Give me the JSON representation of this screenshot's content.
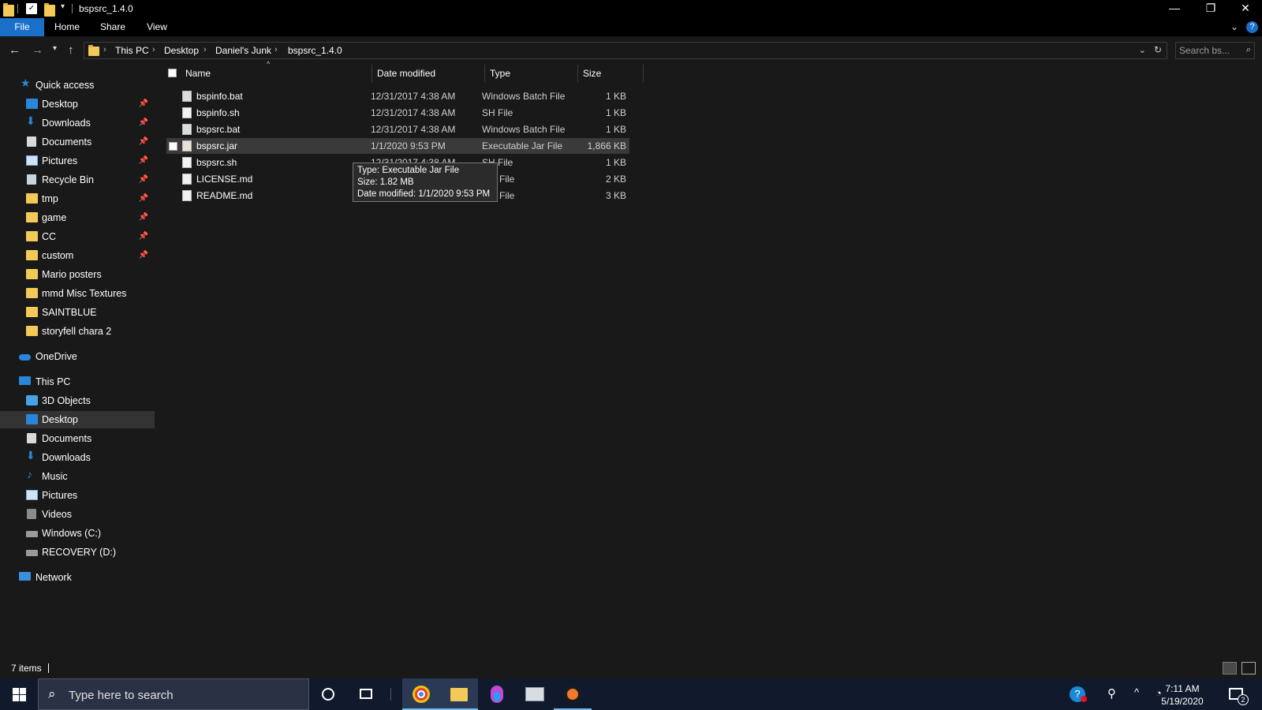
{
  "window": {
    "title": "bspsrc_1.4.0",
    "controls": {
      "minimize": "—",
      "restore": "❐",
      "close": "✕"
    }
  },
  "ribbon": {
    "tabs": [
      "File",
      "Home",
      "Share",
      "View"
    ]
  },
  "address": {
    "crumbs": [
      "This PC",
      "Desktop",
      "Daniel's Junk",
      "bspsrc_1.4.0"
    ],
    "search_placeholder": "Search bs..."
  },
  "nav": {
    "quick_access": "Quick access",
    "quick_items": [
      {
        "label": "Desktop",
        "icon": "desktop-icon",
        "pinned": true
      },
      {
        "label": "Downloads",
        "icon": "downloads-icon",
        "pinned": true
      },
      {
        "label": "Documents",
        "icon": "documents-icon",
        "pinned": true
      },
      {
        "label": "Pictures",
        "icon": "pictures-icon",
        "pinned": true
      },
      {
        "label": "Recycle Bin",
        "icon": "recycle-bin-icon",
        "pinned": true
      },
      {
        "label": "tmp",
        "icon": "folder-icon",
        "pinned": true
      },
      {
        "label": "game",
        "icon": "folder-icon",
        "pinned": true
      },
      {
        "label": "CC",
        "icon": "folder-icon",
        "pinned": true
      },
      {
        "label": "custom",
        "icon": "folder-icon",
        "pinned": true
      },
      {
        "label": "Mario posters",
        "icon": "folder-icon",
        "pinned": false
      },
      {
        "label": "mmd Misc Textures",
        "icon": "folder-icon",
        "pinned": false
      },
      {
        "label": "SAINTBLUE",
        "icon": "folder-icon",
        "pinned": false
      },
      {
        "label": "storyfell chara 2",
        "icon": "folder-icon",
        "pinned": false
      }
    ],
    "onedrive": "OneDrive",
    "this_pc": "This PC",
    "pc_items": [
      {
        "label": "3D Objects",
        "icon": "3d-objects-icon"
      },
      {
        "label": "Desktop",
        "icon": "desktop-icon",
        "selected": true
      },
      {
        "label": "Documents",
        "icon": "documents-icon"
      },
      {
        "label": "Downloads",
        "icon": "downloads-icon"
      },
      {
        "label": "Music",
        "icon": "music-icon"
      },
      {
        "label": "Pictures",
        "icon": "pictures-icon"
      },
      {
        "label": "Videos",
        "icon": "videos-icon"
      },
      {
        "label": "Windows (C:)",
        "icon": "drive-icon"
      },
      {
        "label": "RECOVERY (D:)",
        "icon": "drive-icon"
      }
    ],
    "network": "Network"
  },
  "columns": {
    "name": "Name",
    "date": "Date modified",
    "type": "Type",
    "size": "Size"
  },
  "files": [
    {
      "name": "bspinfo.bat",
      "date": "12/31/2017 4:38 AM",
      "type": "Windows Batch File",
      "size": "1 KB",
      "kind": "bat"
    },
    {
      "name": "bspinfo.sh",
      "date": "12/31/2017 4:38 AM",
      "type": "SH File",
      "size": "1 KB",
      "kind": "sh"
    },
    {
      "name": "bspsrc.bat",
      "date": "12/31/2017 4:38 AM",
      "type": "Windows Batch File",
      "size": "1 KB",
      "kind": "bat"
    },
    {
      "name": "bspsrc.jar",
      "date": "1/1/2020 9:53 PM",
      "type": "Executable Jar File",
      "size": "1,866 KB",
      "kind": "jar",
      "hovered": true
    },
    {
      "name": "bspsrc.sh",
      "date": "12/31/2017 4:38 AM",
      "type": "SH File",
      "size": "1 KB",
      "kind": "sh"
    },
    {
      "name": "LICENSE.md",
      "date": "",
      "type": "MD File",
      "size": "2 KB",
      "kind": "md"
    },
    {
      "name": "README.md",
      "date": "",
      "type": "MD File",
      "size": "3 KB",
      "kind": "md"
    }
  ],
  "tooltip": {
    "line1": "Type: Executable Jar File",
    "line2": "Size: 1.82 MB",
    "line3": "Date modified: 1/1/2020 9:53 PM"
  },
  "status": {
    "items": "7 items"
  },
  "taskbar": {
    "search_placeholder": "Type here to search",
    "time": "7:11 AM",
    "date": "5/19/2020",
    "notifications": "2",
    "colors": {
      "background": "#101a2c",
      "accent": "#76b9ed"
    }
  }
}
